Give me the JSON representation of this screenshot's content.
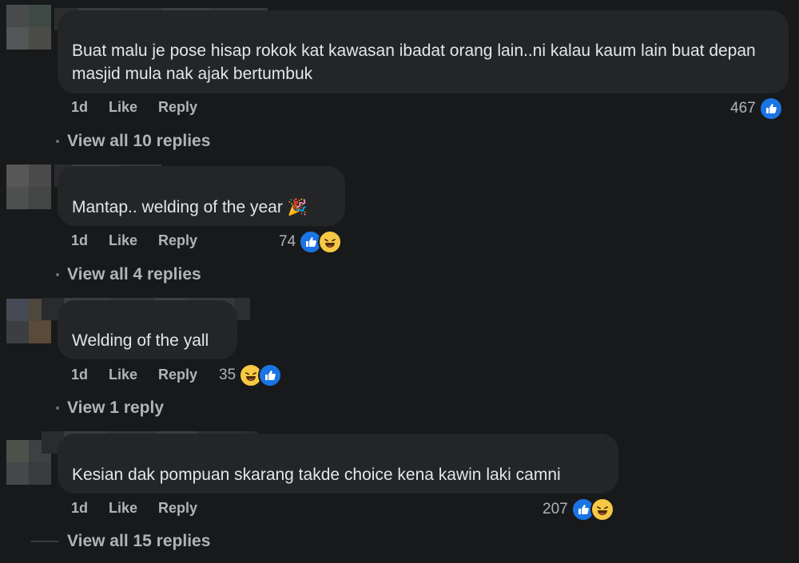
{
  "comments": [
    {
      "text": "Buat malu je pose hisap rokok kat kawasan ibadat orang lain..ni kalau kaum lain buat depan masjid mula nak ajak bertumbuk",
      "time": "1d",
      "like_label": "Like",
      "reply_label": "Reply",
      "reaction_count": "467",
      "reactions": [
        "like-icon"
      ],
      "view_replies": "View all 10 replies"
    },
    {
      "text": "Mantap.. welding of the year",
      "emoji": "🎉",
      "time": "1d",
      "like_label": "Like",
      "reply_label": "Reply",
      "reaction_count": "74",
      "reactions": [
        "like-icon",
        "haha-icon"
      ],
      "view_replies": "View all 4 replies"
    },
    {
      "text": "Welding of the yall",
      "time": "1d",
      "like_label": "Like",
      "reply_label": "Reply",
      "reaction_count": "35",
      "reactions": [
        "haha-icon",
        "like-icon"
      ],
      "view_replies": "View 1 reply"
    },
    {
      "text": "Kesian dak pompuan skarang takde choice kena kawin laki camni",
      "time": "1d",
      "like_label": "Like",
      "reply_label": "Reply",
      "reaction_count": "207",
      "reactions": [
        "like-icon",
        "haha-icon"
      ],
      "view_replies": "View all 15 replies"
    }
  ],
  "colors": {
    "background": "#18191a",
    "bubble": "#242526",
    "text": "#e4e6eb",
    "secondary_text": "#b0b3b8",
    "like_blue": "#1b74e4",
    "haha_yellow": "#f7c844"
  }
}
